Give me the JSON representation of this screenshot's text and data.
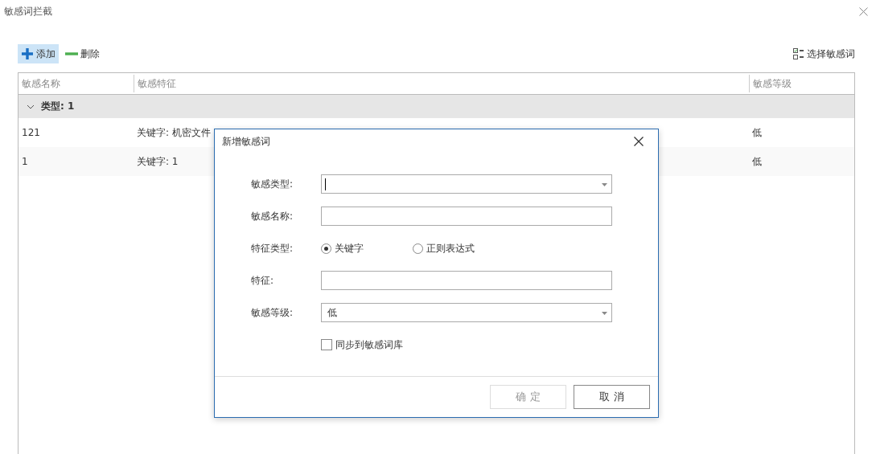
{
  "window": {
    "title": "敏感词拦截"
  },
  "toolbar": [
    {
      "kind": "add",
      "label": "添加",
      "selected": true
    },
    {
      "kind": "delete",
      "label": "删除",
      "selected": false
    }
  ],
  "select_button": {
    "label": "选择敏感词"
  },
  "table": {
    "columns": [
      "敏感名称",
      "敏感特征",
      "敏感等级"
    ],
    "groups": [
      {
        "label": "类型: 1",
        "expanded": true,
        "rows": [
          {
            "cells": [
              "121",
              "关键字: 机密文件",
              "低"
            ]
          },
          {
            "cells": [
              "1",
              "关键字: 1",
              "低"
            ]
          }
        ]
      }
    ]
  },
  "dialog": {
    "title": "新增敏感词",
    "fields": [
      {
        "kind": "combo",
        "label": "敏感类型:",
        "focused": true
      },
      {
        "kind": "text",
        "label": "敏感名称:",
        "focused": false
      },
      {
        "kind": "radio",
        "label": "特征类型:",
        "options": [
          {
            "label": "关键字",
            "selected": true
          },
          {
            "label": "正则表达式",
            "selected": false
          }
        ]
      },
      {
        "kind": "text",
        "label": "特征:",
        "focused": false
      },
      {
        "kind": "combo",
        "label": "敏感等级:",
        "value": "低",
        "focused": false
      },
      {
        "kind": "checkbox",
        "label": "同步到敏感词库",
        "checked": false
      }
    ],
    "buttons": [
      {
        "label": "确 定",
        "disabled": true
      },
      {
        "label": "取 消",
        "disabled": false
      }
    ]
  }
}
